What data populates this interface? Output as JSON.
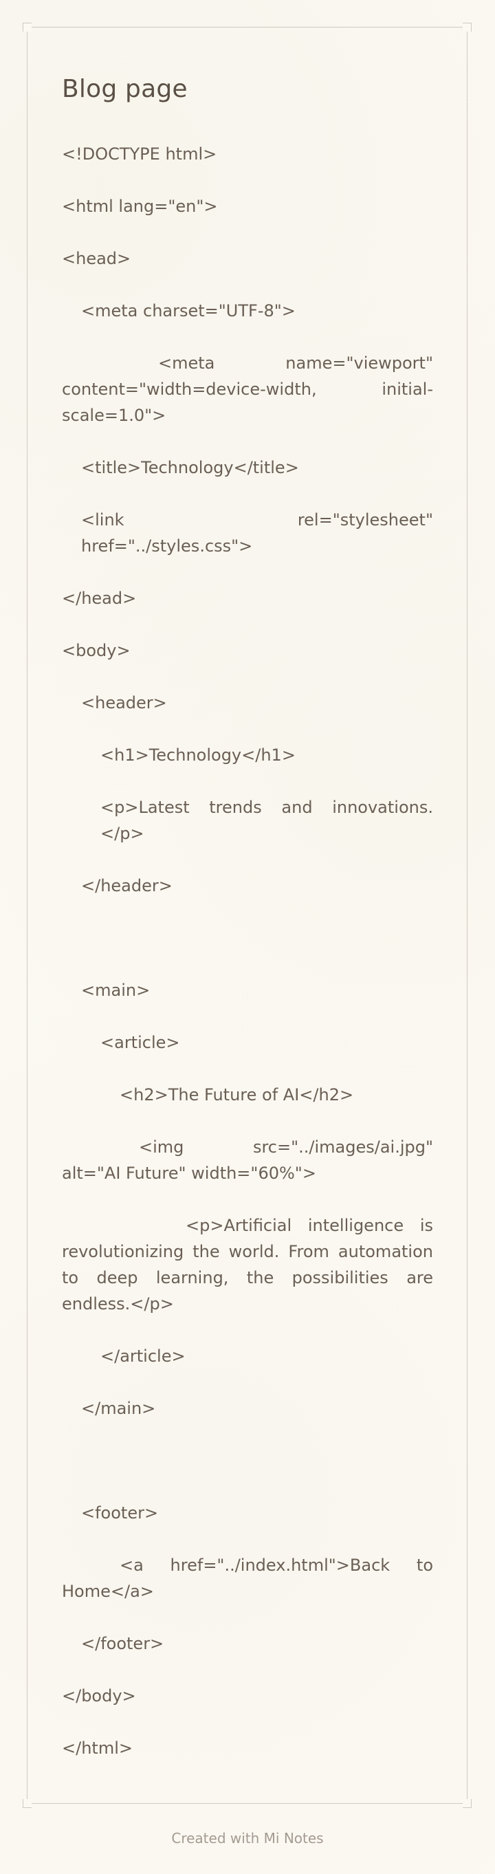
{
  "page": {
    "title": "Blog page",
    "footer_note": "Created with Mi Notes"
  },
  "code_lines": [
    "<!DOCTYPE html>",
    "<html lang=\"en\">",
    "<head>",
    "<meta charset=\"UTF-8\">",
    "<meta name=\"viewport\" content=\"width=device-width, initial-scale=1.0\">",
    "<title>Technology</title>",
    "<link rel=\"stylesheet\" href=\"../styles.css\">",
    "</head>",
    "<body>",
    "<header>",
    "<h1>Technology</h1>",
    "<p>Latest trends and innovations.</p>",
    "</header>",
    "<main>",
    "<article>",
    "<h2>The Future of AI</h2>",
    "<img src=\"../images/ai.jpg\" alt=\"AI Future\" width=\"60%\">",
    "<p>Artificial intelligence is revolutionizing the world. From automation to deep learning, the possibilities are endless.</p>",
    "</article>",
    "</main>",
    "<footer>",
    "<a href=\"../index.html\">Back to Home</a>",
    "</footer>",
    "</body>",
    "</html>"
  ]
}
